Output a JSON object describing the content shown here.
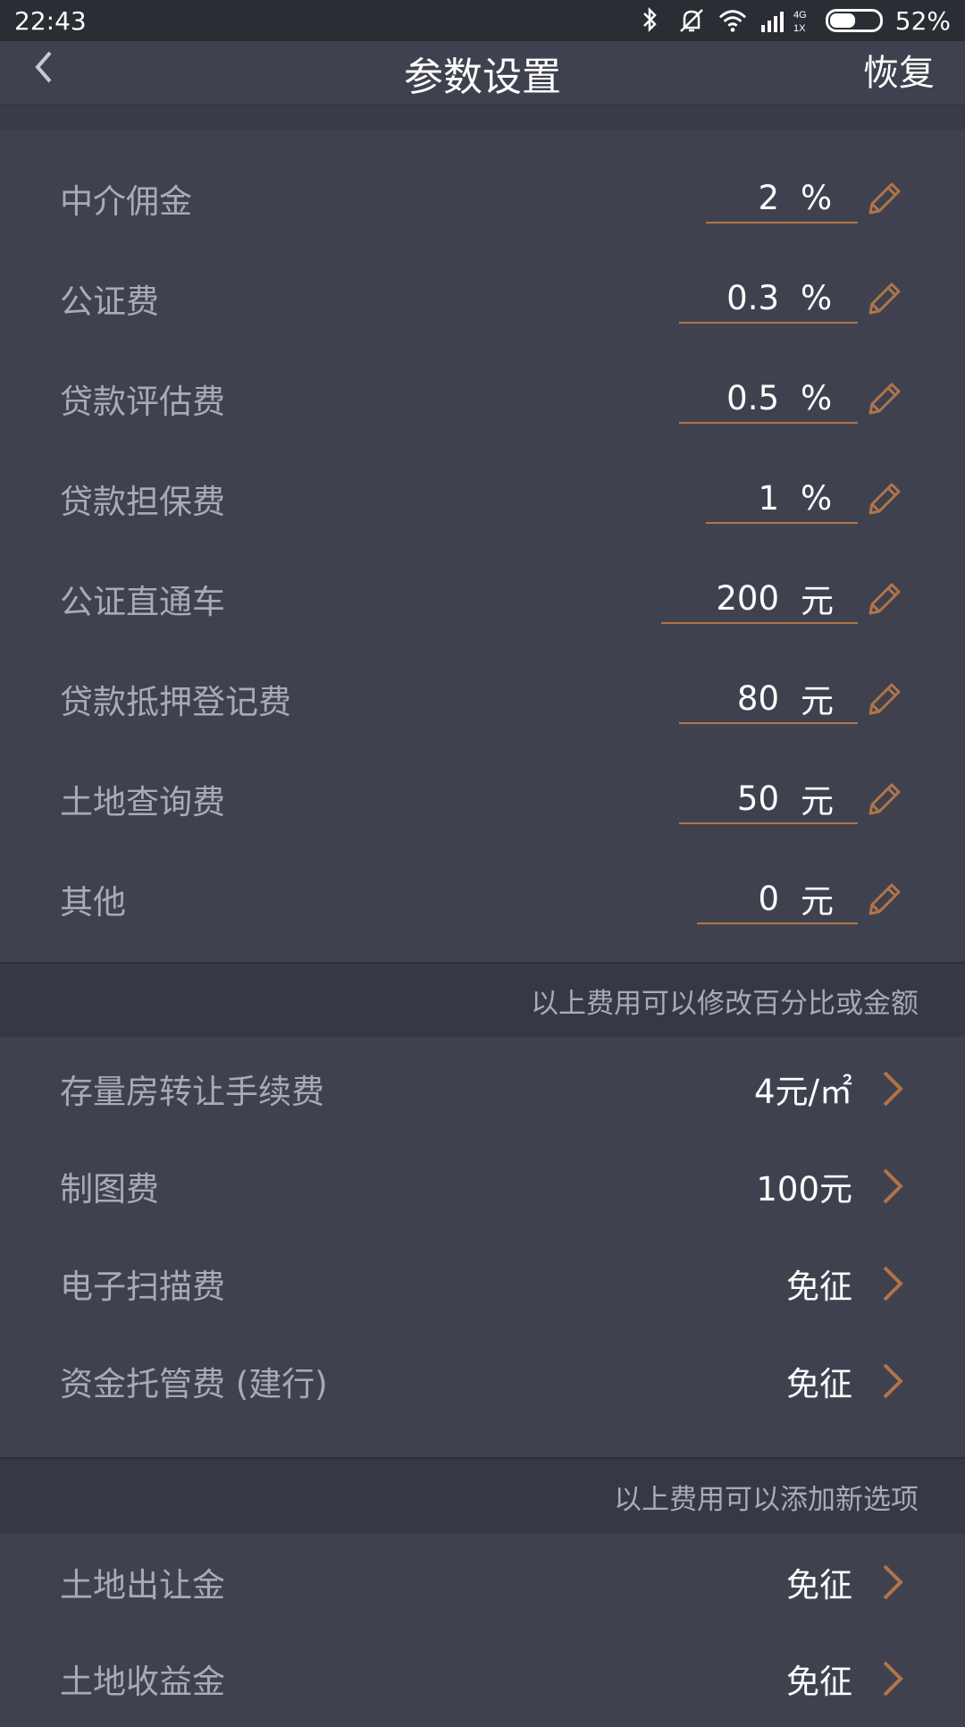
{
  "status": {
    "time": "22:43",
    "network": "4G",
    "network_sub": "1X",
    "battery": "52%",
    "battery_level": 0.52
  },
  "header": {
    "back_icon": "chevron-left-icon",
    "title": "参数设置",
    "restore_label": "恢复"
  },
  "editable_fees": [
    {
      "label": "中介佣金",
      "value": "2",
      "unit": "%"
    },
    {
      "label": "公证费",
      "value": "0.3",
      "unit": "%"
    },
    {
      "label": "贷款评估费",
      "value": "0.5",
      "unit": "%"
    },
    {
      "label": "贷款担保费",
      "value": "1",
      "unit": "%"
    },
    {
      "label": "公证直通车",
      "value": "200",
      "unit": "元"
    },
    {
      "label": "贷款抵押登记费",
      "value": "80",
      "unit": "元"
    },
    {
      "label": "土地查询费",
      "value": "50",
      "unit": "元"
    },
    {
      "label": "其他",
      "value": "0",
      "unit": "元"
    }
  ],
  "note1": "以上费用可以修改百分比或金额",
  "option_fees": [
    {
      "label": "存量房转让手续费",
      "value": "4元/㎡"
    },
    {
      "label": "制图费",
      "value": "100元"
    },
    {
      "label": "电子扫描费",
      "value": "免征"
    },
    {
      "label": "资金托管费 (建行)",
      "value": "免征"
    }
  ],
  "note2": "以上费用可以添加新选项",
  "extra_fees": [
    {
      "label": "土地出让金",
      "value": "免征"
    },
    {
      "label": "土地收益金",
      "value": "免征"
    }
  ],
  "colors": {
    "background": "#3f424e",
    "accent": "#b0744a",
    "label": "#a8abb6",
    "value": "#ffffff"
  }
}
